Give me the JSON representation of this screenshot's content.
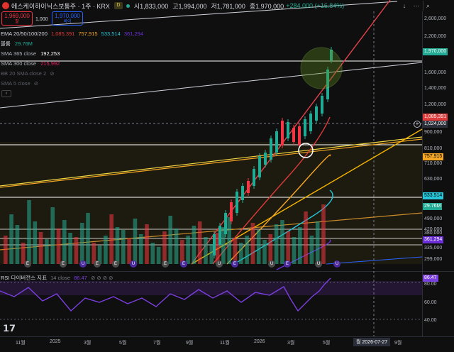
{
  "header": {
    "symbol": "에스케이하이닉스보통주 · 1주 · KRX",
    "badge": "D",
    "ohlc_o": "시1,833,000",
    "ohlc_h": "고1,994,000",
    "ohlc_l": "저1,781,000",
    "ohlc_c": "종1,970,000",
    "change": "+284,000 (+16.84%)"
  },
  "price_boxes": {
    "sell_price": "1,969,000",
    "sell_label": "팔",
    "mid_value": "1,000",
    "buy_price": "1,970,000",
    "buy_label": "바이"
  },
  "indicators": {
    "ema_label": "EMA 20/50/100/200",
    "ema_v1": "1,085,391",
    "ema_v2": "757,915",
    "ema_v3": "533,514",
    "ema_v4": "361,294",
    "volume_label": "볼륨",
    "volume_value": "29.76M",
    "sma365_label": "SMA 365 close",
    "sma365_value": "192,253",
    "sma300_label": "SMA 300 close",
    "sma300_value": "215,992",
    "bb_label": "BB 20 SMA close 2",
    "sma5_label": "SMA 5 close"
  },
  "price_axis": {
    "ticks": [
      "2,600,000",
      "2,200,000",
      "1,600,000",
      "1,400,000",
      "1,200,000",
      "900,000",
      "810,000",
      "710,000",
      "630,000",
      "490,000",
      "420,000",
      "380,000",
      "335,000",
      "299,000"
    ],
    "tags": {
      "last": "1,970,000",
      "ema20": "1,085,391",
      "crosshair": "1,024,000",
      "ema50": "757,915",
      "ema100": "533,514",
      "volume": "29.76M",
      "ema200": "361,294"
    }
  },
  "rsi": {
    "label": "RSI 다이버전스 지표",
    "params": "14 close",
    "value": "86.47",
    "ticks": [
      "80.00",
      "60.00",
      "40.00"
    ]
  },
  "time_axis": {
    "labels": [
      "11월",
      "2025",
      "3월",
      "5월",
      "7월",
      "9월",
      "11월",
      "2026",
      "3월",
      "5월",
      "9월"
    ],
    "cursor_label": "월 2026-07-27"
  },
  "event_badges": [
    "E",
    "E",
    "U",
    "E",
    "E",
    "U",
    "E",
    "E",
    "U",
    "E",
    "U",
    "E",
    "U",
    "U"
  ],
  "colors": {
    "up": "#22ab94",
    "down": "#f23645",
    "ema20": "#e03a3a",
    "ema50": "#f5a623",
    "ema100": "#26c6da",
    "ema200": "#6b2fd8",
    "rsi": "#7b3fe0"
  }
}
